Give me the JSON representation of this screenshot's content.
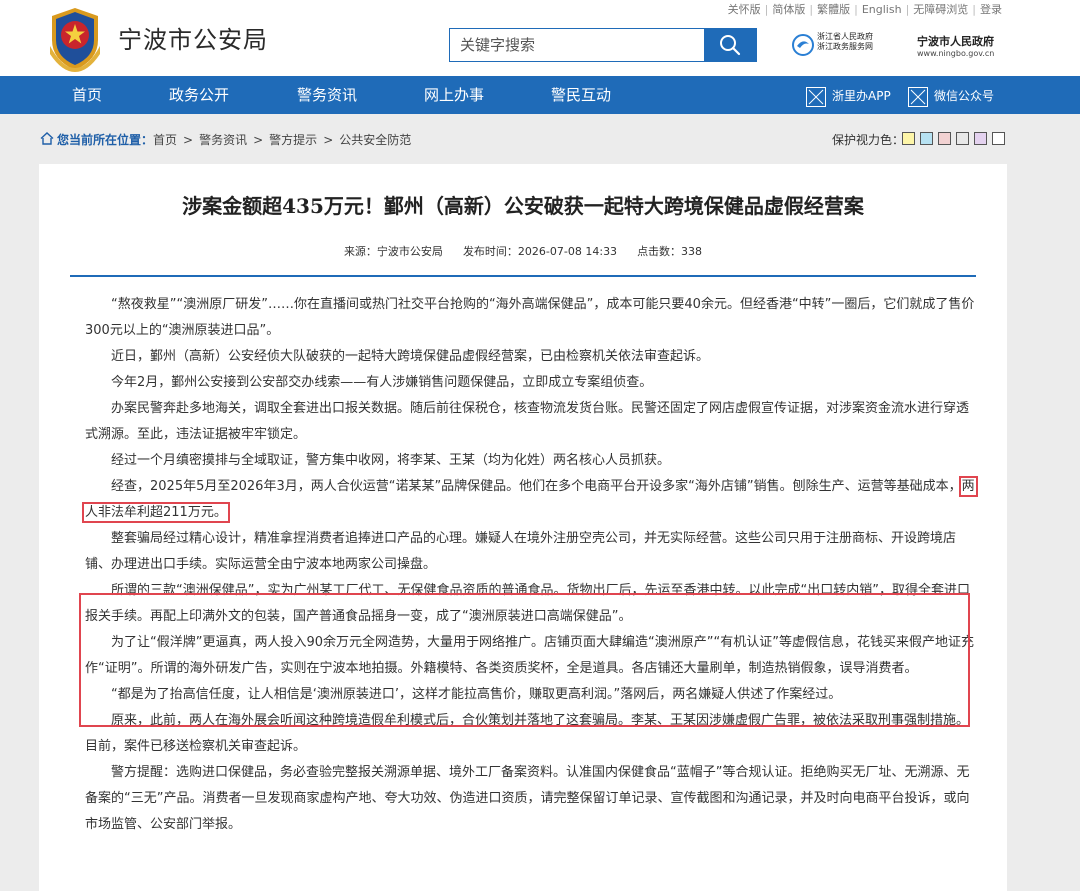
{
  "header": {
    "top_links": [
      "关怀版",
      "简体版",
      "繁體版",
      "English",
      "无障碍浏览",
      "登录"
    ],
    "site_title": "宁波市公安局",
    "search": {
      "placeholder": "关键字搜索",
      "value": ""
    },
    "zj_logo": {
      "line1": "浙江省人民政府",
      "line2": "浙江政务服务网"
    },
    "nb_logo": {
      "line1": "宁波市人民政府",
      "line2": "www.ningbo.gov.cn"
    }
  },
  "nav": {
    "items": [
      "首页",
      "政务公开",
      "警务资讯",
      "网上办事",
      "警民互动"
    ],
    "extras": [
      "浙里办APP",
      "微信公众号"
    ]
  },
  "breadcrumb": {
    "lead": "您当前所在位置：",
    "items": [
      "首页",
      "警务资讯",
      "警方提示",
      "公共安全防范"
    ],
    "separator": ">"
  },
  "eye_care": {
    "label": "保护视力色：",
    "colors": [
      "#fdf5a8",
      "#b7e2f2",
      "#f2d2d2",
      "#e8e8e8",
      "#e4d2ef",
      "#ffffff"
    ]
  },
  "article": {
    "title": "涉案金额超435万元！鄞州（高新）公安破获一起特大跨境保健品虚假经营案",
    "source_label": "来源：宁波市公安局",
    "time_label": "发布时间：2026-07-08 14:33",
    "clicks_label": "点击数：338",
    "paragraphs": [
      "“熬夜救星”“澳洲原厂研发”……你在直播间或热门社交平台抢购的“海外高端保健品”，成本可能只要40余元。但经香港“中转”一圈后，它们就成了售价300元以上的“澳洲原装进口品”。",
      "近日，鄞州（高新）公安经侦大队破获的一起特大跨境保健品虚假经营案，已由检察机关依法审查起诉。",
      "今年2月，鄞州公安接到公安部交办线索——有人涉嫌销售问题保健品，立即成立专案组侦查。",
      "办案民警奔赴多地海关，调取全套进出口报关数据。随后前往保税仓，核查物流发货台账。民警还固定了网店虚假宣传证据，对涉案资金流水进行穿透式溯源。至此，违法证据被牢牢锁定。",
      "经过一个月缜密摸排与全域取证，警方集中收网，将李某、王某（均为化姓）两名核心人员抓获。"
    ],
    "p6_main": "经查，2025年5月至2026年3月，两人合伙运营“诺某某”品牌保健品。他们在多个电商平台开设多家“海外店铺”销售。刨除生产、运营等基础成本，",
    "p6_highlight": "两人非法牟利超211万元。",
    "p7": "整套骗局经过精心设计，精准拿捏消费者追捧进口产品的心理。嫌疑人在境外注册空壳公司，并无实际经营。这些公司只用于注册商标、开设跨境店铺、办理进出口手续。实际运营全由宁波本地两家公司操盘。",
    "boxed_paragraphs": [
      "所谓的三款“澳洲保健品”，实为广州某工厂代工、无保健食品资质的普通食品。货物出厂后，先运至香港中转。以此完成“出口转内销”，取得全套进口报关手续。再配上印满外文的包装，国产普通食品摇身一变，成了“澳洲原装进口高端保健品”。",
      "为了让“假洋牌”更逼真，两人投入90余万元全网造势，大量用于网络推广。店铺页面大肆编造“澳洲原产”“有机认证”等虚假信息，花钱买来假产地证充作“证明”。所谓的海外研发广告，实则在宁波本地拍摄。外籍模特、各类资质奖杯，全是道具。各店铺还大量刷单，制造热销假象，误导消费者。"
    ],
    "tail_paragraphs": [
      "“都是为了抬高信任度，让人相信是‘澳洲原装进口’，这样才能拉高售价，赚取更高利润。”落网后，两名嫌疑人供述了作案经过。",
      "原来，此前，两人在海外展会听闻这种跨境造假牟利模式后，合伙策划并落地了这套骗局。李某、王某因涉嫌虚假广告罪，被依法采取刑事强制措施。目前，案件已移送检察机关审查起诉。",
      "警方提醒：选购进口保健品，务必查验完整报关溯源单据、境外工厂备案资料。认准国内保健食品“蓝帽子”等合规认证。拒绝购买无厂址、无溯源、无备案的“三无”产品。消费者一旦发现商家虚构产地、夸大功效、伪造进口资质，请完整保留订单记录、宣传截图和沟通记录，并及时向电商平台投诉，或向市场监管、公安部门举报。"
    ]
  },
  "colors": {
    "brand_blue": "#1f6bb8",
    "highlight_red": "#e0454f"
  }
}
